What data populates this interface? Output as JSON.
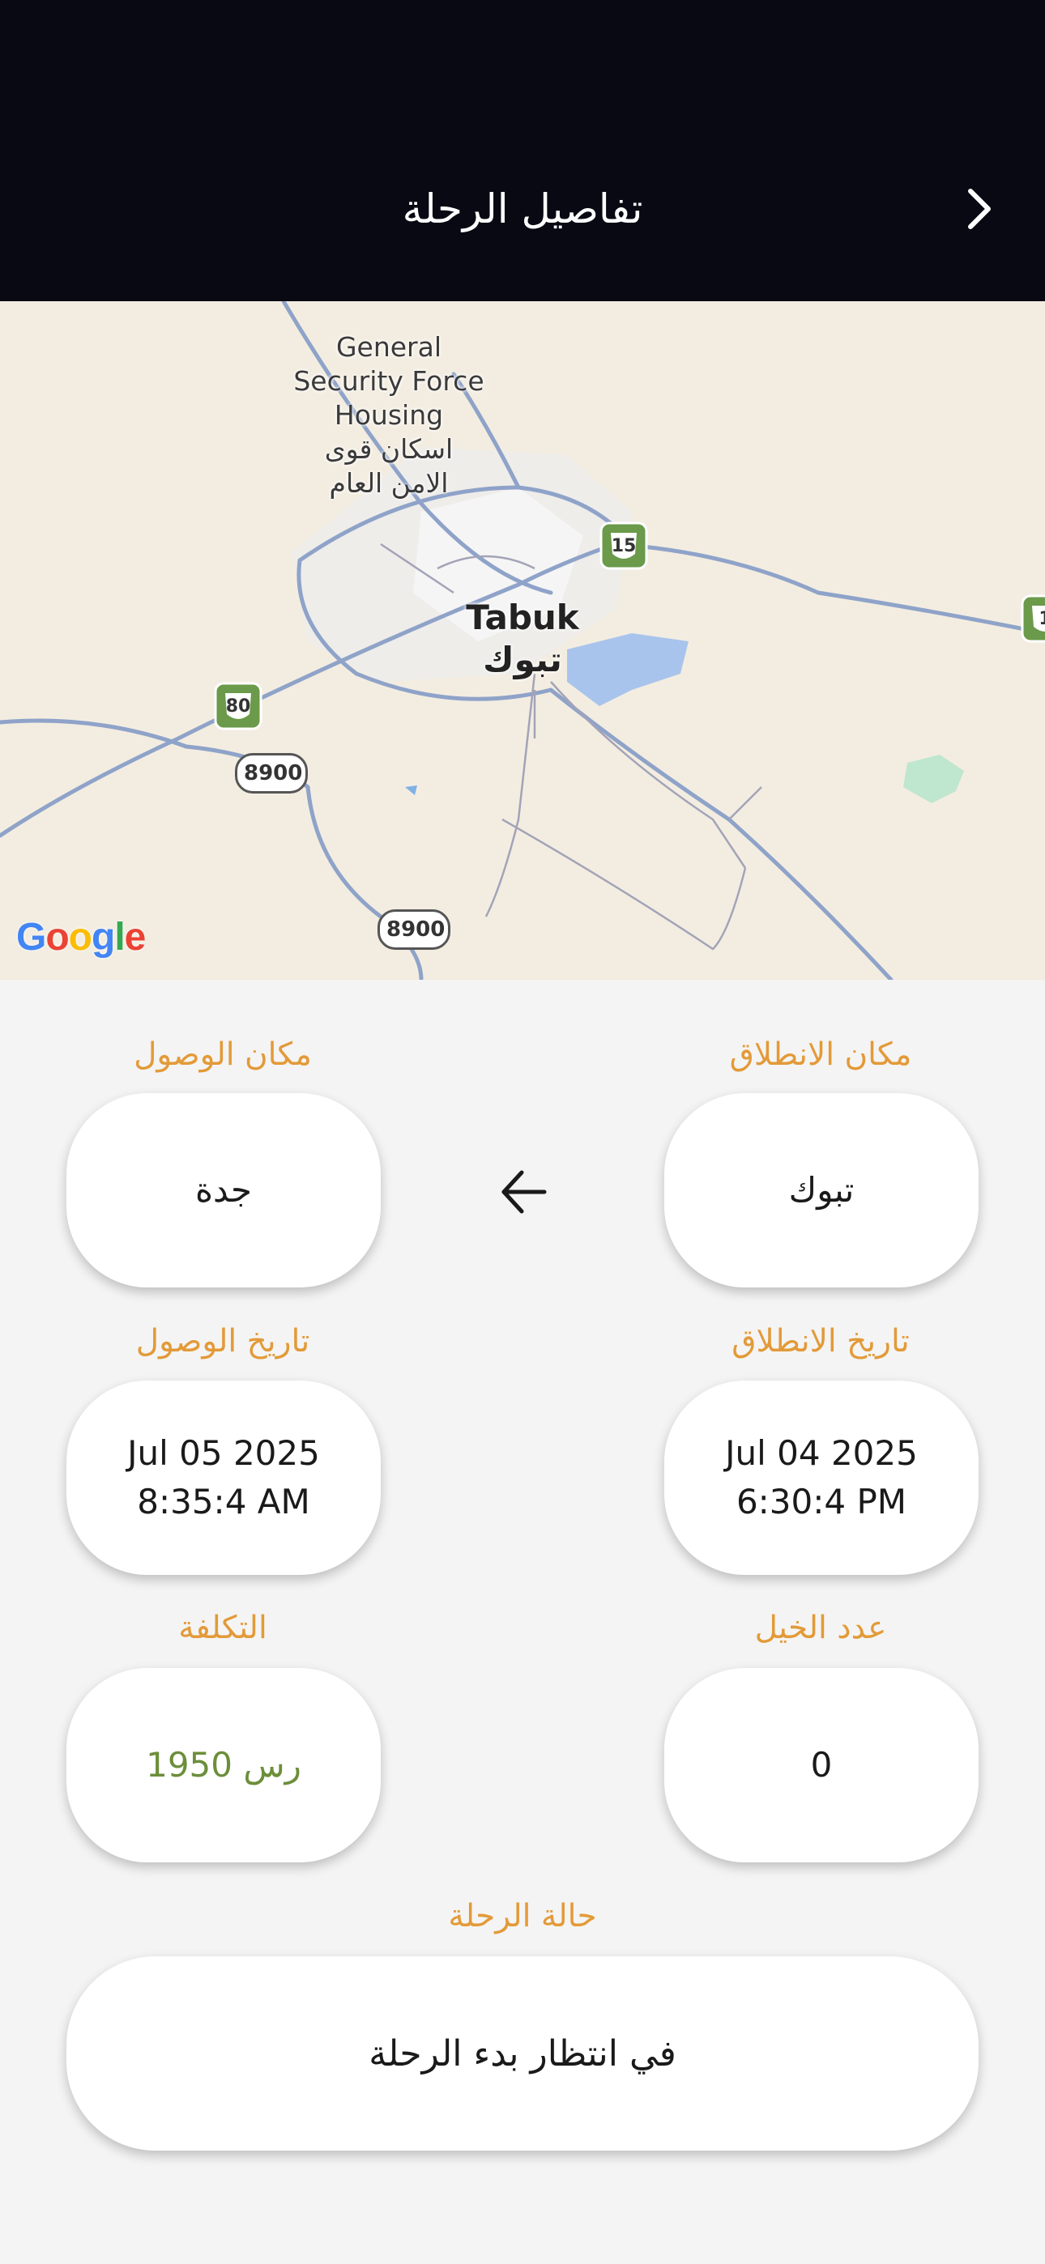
{
  "header": {
    "title": "تفاصيل الرحلة",
    "back_icon": "chevron-right-icon"
  },
  "map": {
    "place_label_en": "General\nSecurity Force\nHousing",
    "place_label_ar": "اسكان قوى\nالامن العام",
    "city_en": "Tabuk",
    "city_ar": "تبوك",
    "shields": [
      "15",
      "80",
      "1"
    ],
    "road_badges": [
      "8900",
      "8900"
    ],
    "attribution": "Google"
  },
  "trip": {
    "departure_place_label": "مكان الانطلاق",
    "departure_place": "تبوك",
    "arrival_place_label": "مكان الوصول",
    "arrival_place": "جدة",
    "route_icon": "arrow-left-icon",
    "departure_date_label": "تاريخ الانطلاق",
    "departure_date": "Jul 04 2025",
    "departure_time": "6:30:4 PM",
    "arrival_date_label": "تاريخ الوصول",
    "arrival_date": "Jul 05 2025",
    "arrival_time": "8:35:4 AM",
    "horses_label": "عدد الخيل",
    "horses_count": "0",
    "cost_label": "التكلفة",
    "cost_value": "1950 رس",
    "status_label": "حالة الرحلة",
    "status_value": "في انتظار بدء الرحلة"
  },
  "colors": {
    "header_bg": "#080913",
    "label_orange": "#e39a38",
    "cost_green": "#6c8e3a",
    "page_bg": "#f4f4f4"
  }
}
